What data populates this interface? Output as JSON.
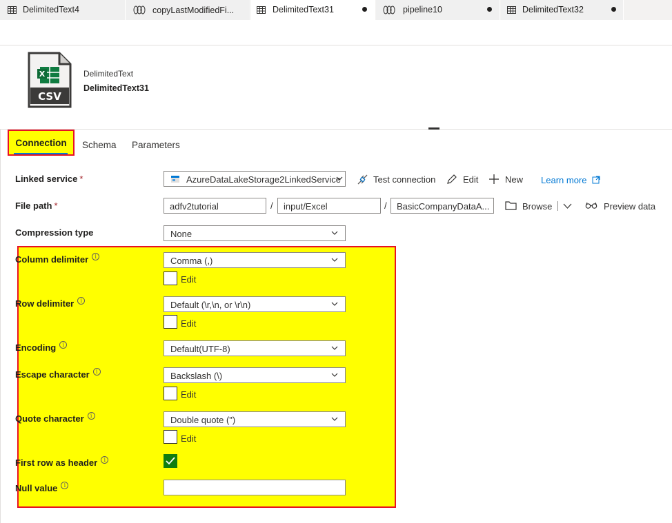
{
  "tabs": [
    {
      "label": "DelimitedText4",
      "icon": "table-icon",
      "active": false,
      "modified": false
    },
    {
      "label": "copyLastModifiedFi...",
      "icon": "pipeline-icon",
      "active": false,
      "modified": false
    },
    {
      "label": "DelimitedText31",
      "icon": "table-icon",
      "active": true,
      "modified": true
    },
    {
      "label": "pipeline10",
      "icon": "pipeline-icon",
      "active": false,
      "modified": true
    },
    {
      "label": "DelimitedText32",
      "icon": "table-icon",
      "active": false,
      "modified": true
    }
  ],
  "header": {
    "icon_text": "CSV",
    "dataset_type": "DelimitedText",
    "dataset_name": "DelimitedText31"
  },
  "section_tabs": {
    "connection": "Connection",
    "schema": "Schema",
    "parameters": "Parameters"
  },
  "linked_service": {
    "label": "Linked service",
    "required_mark": "*",
    "value": "AzureDataLakeStorage2LinkedService",
    "test_connection": "Test connection",
    "edit": "Edit",
    "new": "New",
    "learn_more": "Learn more"
  },
  "file_path": {
    "label": "File path",
    "required_mark": "*",
    "container": "adfv2tutorial",
    "directory": "input/Excel",
    "file": "BasicCompanyDataA...",
    "separator": "/",
    "browse": "Browse",
    "preview": "Preview data"
  },
  "compression": {
    "label": "Compression type",
    "value": "None"
  },
  "column_delimiter": {
    "label": "Column delimiter",
    "value": "Comma (,)",
    "edit_label": "Edit"
  },
  "row_delimiter": {
    "label": "Row delimiter",
    "value": "Default (\\r,\\n, or \\r\\n)",
    "edit_label": "Edit"
  },
  "encoding": {
    "label": "Encoding",
    "value": "Default(UTF-8)"
  },
  "escape_character": {
    "label": "Escape character",
    "value": "Backslash (\\)",
    "edit_label": "Edit"
  },
  "quote_character": {
    "label": "Quote character",
    "value": "Double quote (\")",
    "edit_label": "Edit"
  },
  "first_row_header": {
    "label": "First row as header",
    "checked": true
  },
  "null_value": {
    "label": "Null value",
    "value": ""
  },
  "colors": {
    "accent": "#0078d4",
    "highlight": "#ffff00",
    "highlight_border": "#e81123",
    "checkbox_checked": "#107c10",
    "excel_green": "#107c41"
  }
}
